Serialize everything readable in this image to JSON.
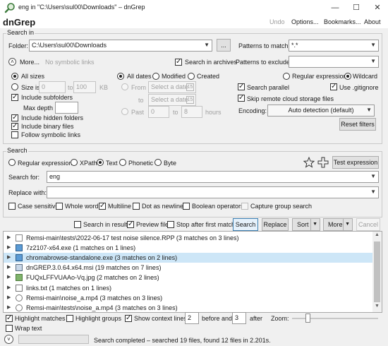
{
  "window": {
    "title": "eng in \"C:\\Users\\sul00\\Downloads\" – dnGrep"
  },
  "menu": {
    "app_name": "dnGrep",
    "undo": "Undo",
    "options": "Options...",
    "bookmarks": "Bookmarks...",
    "about": "About"
  },
  "search_in": {
    "legend": "Search in",
    "folder_label": "Folder:",
    "folder_value": "C:\\Users\\sul00\\Downloads",
    "browse_label": "...",
    "patterns_match_label": "Patterns to match:",
    "patterns_match_value": "*.*",
    "more_label": "More...",
    "no_symlinks": "No symbolic links",
    "search_archives": "Search in archives",
    "patterns_exclude_label": "Patterns to exclude:",
    "patterns_exclude_value": "",
    "all_sizes": "All sizes",
    "size_is": "Size is",
    "size_from": "0",
    "size_to_label": "to",
    "size_to": "100",
    "size_unit": "KB",
    "include_subfolders": "Include subfolders",
    "max_depth": "Max depth",
    "include_hidden": "Include hidden folders",
    "include_binary": "Include binary files",
    "follow_symlinks": "Follow symbolic links",
    "all_dates": "All dates",
    "modified": "Modified",
    "created": "Created",
    "from_label": "From",
    "date_placeholder": "Select a date",
    "cal_icon": "15",
    "to_label": "to",
    "past_label": "Past",
    "past_from": "0",
    "past_to_label": "to",
    "past_to": "8",
    "hours_label": "hours",
    "regex": "Regular expression",
    "wildcard": "Wildcard",
    "search_parallel": "Search parallel",
    "use_gitignore": "Use .gitignore",
    "skip_cloud": "Skip remote cloud storage files",
    "encoding_label": "Encoding:",
    "encoding_value": "Auto detection (default)",
    "reset_filters": "Reset filters"
  },
  "search": {
    "legend": "Search",
    "type_regex": "Regular expression",
    "type_xpath": "XPath",
    "type_text": "Text",
    "type_phonetic": "Phonetic",
    "type_byte": "Byte",
    "test_expression": "Test expression",
    "search_for_label": "Search for:",
    "search_for_value": "eng",
    "replace_with_label": "Replace with:",
    "replace_with_value": "",
    "case_sensitive": "Case sensitive",
    "whole_word": "Whole word",
    "multiline": "Multiline",
    "dot_newline": "Dot as newline",
    "boolean_ops": "Boolean operators",
    "capture_group": "Capture group search"
  },
  "actions": {
    "search_in_results": "Search in results",
    "preview_file": "Preview file",
    "stop_after_first": "Stop after first match",
    "search": "Search",
    "replace": "Replace",
    "sort": "Sort",
    "more": "More",
    "cancel": "Cancel"
  },
  "results": [
    {
      "text": "Remsi-main\\tests\\2022-06-17 test noise silence.RPP (3 matches on 3 lines)",
      "icon": "document-icon"
    },
    {
      "text": "7z2107-x64.exe (1 matches on 1 lines)",
      "icon": "app-icon"
    },
    {
      "text": "chromabrowse-standalone.exe (3 matches on 2 lines)",
      "icon": "app-icon"
    },
    {
      "text": "dnGREP.3.0.64.x64.msi (19 matches on 7 lines)",
      "icon": "installer-icon"
    },
    {
      "text": "FUQxLFFVUAAo-Vq.jpg (2 matches on 2 lines)",
      "icon": "image-icon"
    },
    {
      "text": "links.txt (1 matches on 1 lines)",
      "icon": "text-file-icon"
    },
    {
      "text": "Remsi-main\\noise_a.mp4 (3 matches on 3 lines)",
      "icon": "video-icon"
    },
    {
      "text": "Remsi-main\\tests\\noise_a.mp4 (3 matches on 3 lines)",
      "icon": "video-icon"
    }
  ],
  "bottom": {
    "highlight_matches": "Highlight matches",
    "highlight_groups": "Highlight groups",
    "show_context": "Show context lines",
    "before_value": "2",
    "before_label": "before and",
    "after_value": "3",
    "after_label": "after",
    "zoom_label": "Zoom:",
    "wrap_text": "Wrap text",
    "status": "Search completed – searched 19 files, found 12 files in 2.201s."
  }
}
